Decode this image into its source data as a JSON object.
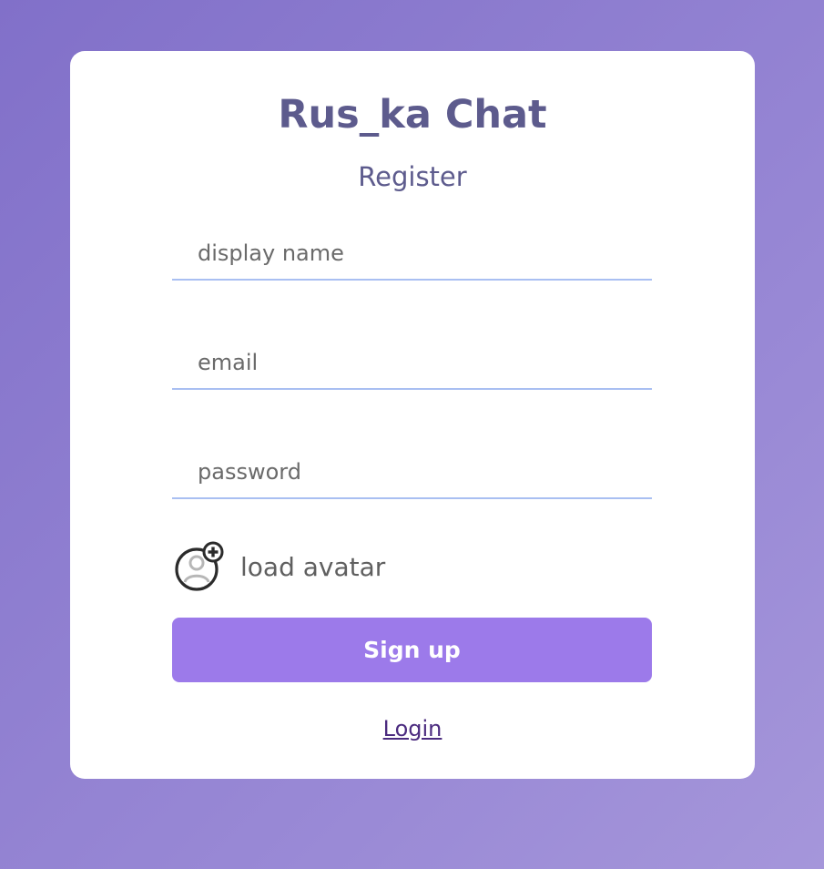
{
  "app": {
    "title": "Rus_ka Chat",
    "subtitle": "Register"
  },
  "form": {
    "display_name_placeholder": "display name",
    "email_placeholder": "email",
    "password_placeholder": "password",
    "avatar_label": "load avatar",
    "avatar_icon": "add-avatar-icon",
    "signup_label": "Sign up",
    "login_link": "Login"
  },
  "colors": {
    "accent": "#9c7aea",
    "heading": "#5d5b8d",
    "input_underline": "#a9bff2",
    "link": "#4b2b7f"
  }
}
